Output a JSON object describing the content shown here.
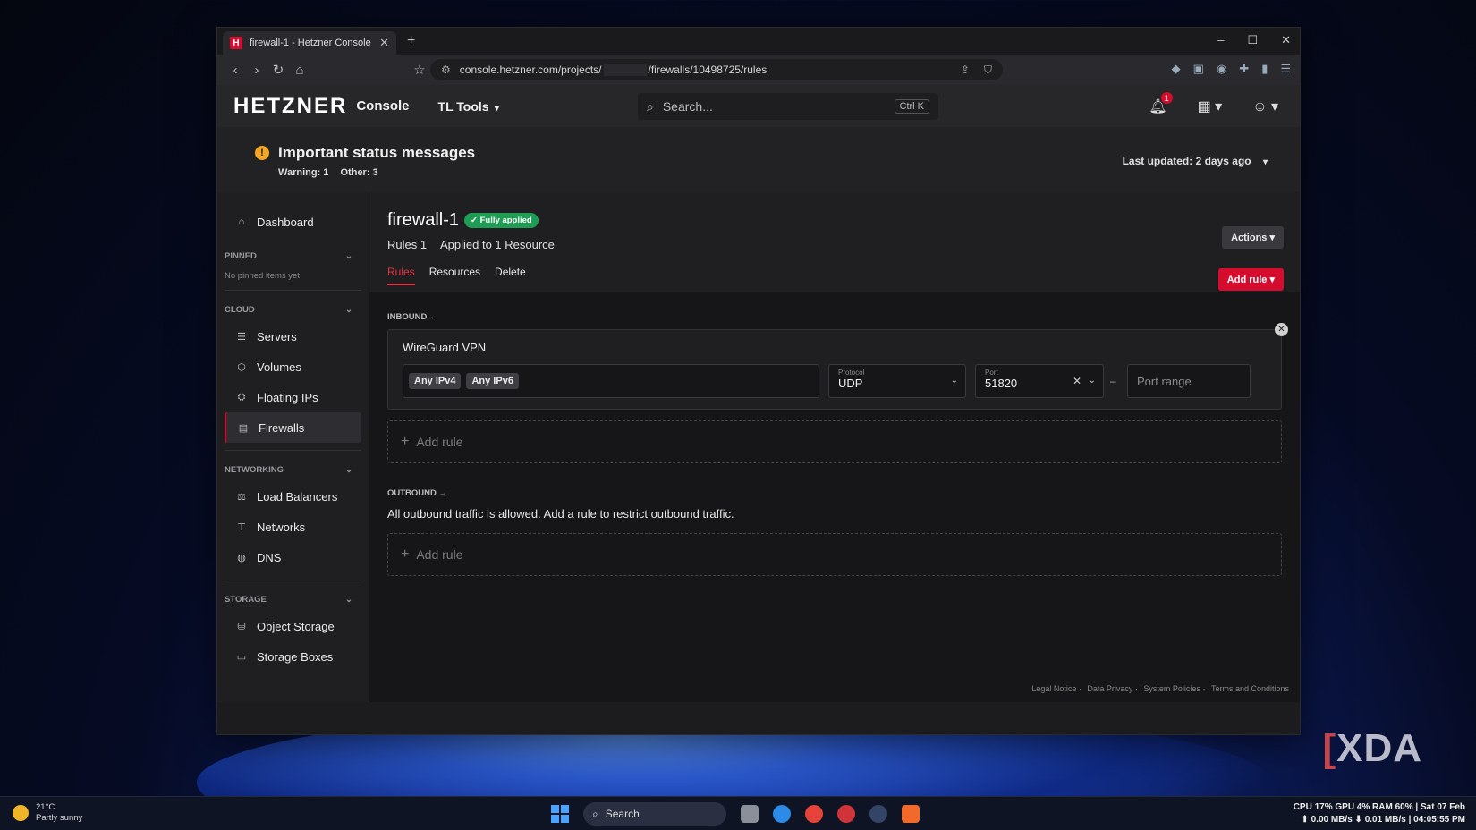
{
  "browser": {
    "tab_title": "firewall-1 - Hetzner Console",
    "tab_favicon": "H",
    "url_prefix": "console.hetzner.com/projects/",
    "url_suffix": "/firewalls/10498725/rules",
    "new_tab": "+",
    "minimize": "–",
    "maximize": "☐",
    "close": "✕"
  },
  "header": {
    "brand": "HETZNER",
    "console": "Console",
    "project": "TL Tools",
    "search_placeholder": "Search...",
    "search_shortcut": "Ctrl K",
    "notification_count": "1"
  },
  "status": {
    "title": "Important status messages",
    "warning": "Warning: 1",
    "other": "Other: 3",
    "last_updated_label": "Last updated:",
    "last_updated_value": "2 days ago"
  },
  "sidebar": {
    "dashboard": "Dashboard",
    "pinned_group": "PINNED",
    "pinned_note": "No pinned items yet",
    "cloud_group": "CLOUD",
    "cloud_items": [
      "Servers",
      "Volumes",
      "Floating IPs",
      "Firewalls"
    ],
    "networking_group": "NETWORKING",
    "networking_items": [
      "Load Balancers",
      "Networks",
      "DNS"
    ],
    "storage_group": "STORAGE",
    "storage_items": [
      "Object Storage",
      "Storage Boxes"
    ]
  },
  "firewall": {
    "name": "firewall-1",
    "badge": "✓ Fully applied",
    "rules_count": "Rules 1",
    "applied_to": "Applied to 1 Resource",
    "tabs": [
      "Rules",
      "Resources",
      "Delete"
    ],
    "actions_label": "Actions",
    "add_rule_label": "Add rule"
  },
  "inbound": {
    "label": "INBOUND ←",
    "rule": {
      "description": "WireGuard VPN",
      "sources": [
        "Any IPv4",
        "Any IPv6"
      ],
      "protocol_label": "Protocol",
      "protocol_value": "UDP",
      "port_label": "Port",
      "port_value": "51820",
      "port_range_placeholder": "Port range"
    },
    "add_rule": "Add rule"
  },
  "outbound": {
    "label": "OUTBOUND →",
    "note": "All outbound traffic is allowed. Add a rule to restrict outbound traffic.",
    "add_rule": "Add rule"
  },
  "footer": {
    "links": [
      "Legal Notice",
      "Data Privacy",
      "System Policies",
      "Terms and Conditions"
    ]
  },
  "taskbar": {
    "temperature": "21°C",
    "weather": "Partly sunny",
    "search": "Search",
    "sys_line1": "CPU 17% GPU   4% RAM 60% | Sat 07 Feb",
    "sys_line2": "⬆ 0.00 MB/s ⬇ 0.01 MB/s | 04:05:55 PM"
  },
  "watermark": "XDA",
  "colors": {
    "brand_red": "#d50c2d",
    "applied_green": "#1f9d55",
    "warning_orange": "#f5a623"
  }
}
